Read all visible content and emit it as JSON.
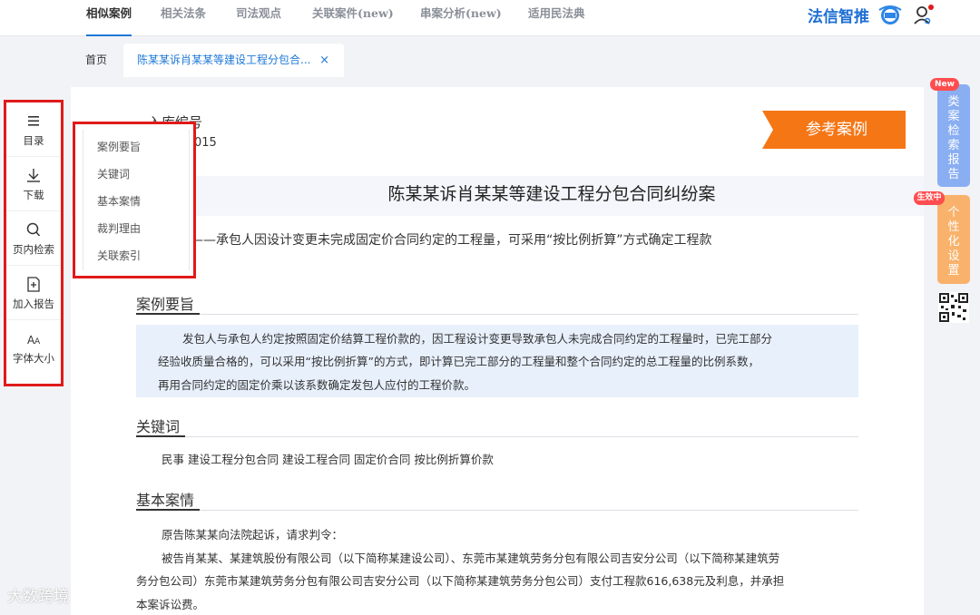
{
  "topnav": {
    "tabs": [
      {
        "label": "相似案例",
        "active": true
      },
      {
        "label": "相关法条",
        "active": false
      },
      {
        "label": "司法观点",
        "active": false
      },
      {
        "label": "关联案件(new)",
        "active": false
      },
      {
        "label": "串案分析(new)",
        "active": false
      },
      {
        "label": "适用民法典",
        "active": false
      }
    ],
    "brand": "法信智推",
    "accent_color": "#1e78d7"
  },
  "pagetabs": {
    "home": "首页",
    "case": "陈某某诉肖某某等建设工程分包合...",
    "close_icon": "×"
  },
  "lefttool": [
    {
      "label": "目录",
      "icon": "list-icon"
    },
    {
      "label": "下载",
      "icon": "download-icon"
    },
    {
      "label": "页内检索",
      "icon": "search-icon"
    },
    {
      "label": "加入报告",
      "icon": "add-report-icon"
    },
    {
      "label": "字体大小",
      "icon": "font-size-icon"
    }
  ],
  "outline": [
    "案例要旨",
    "关键词",
    "基本案情",
    "裁判理由",
    "关联索引"
  ],
  "case": {
    "number_label": "入库编号",
    "number_suffix": "5-015",
    "ref_badge": "参考案例",
    "title": "陈某某诉肖某某等建设工程分包合同纠纷案",
    "subtitle": "——承包人因设计变更未完成固定价合同约定的工程量，可采用“按比例折算”方式确定工程款"
  },
  "sections": {
    "summary": {
      "heading": "案例要旨",
      "lines": [
        "发包人与承包人约定按照固定价结算工程价款的，因工程设计变更导致承包人未完成合同约定的工程量时，已完工部分",
        "经验收质量合格的，可以采用“按比例折算”的方式，即计算已完工部分的工程量和整个合同约定的总工程量的比例系数，",
        "再用合同约定的固定价乘以该系数确定发包人应付的工程价款。"
      ]
    },
    "keywords": {
      "heading": "关键词",
      "text": "民事 建设工程分包合同 建设工程合同 固定价合同 按比例折算价款"
    },
    "facts": {
      "heading": "基本案情",
      "lines": [
        "原告陈某某向法院起诉，请求判令：",
        "被告肖某某、某建筑股份有限公司（以下简称某建设公司）、东莞市某建筑劳务分包有限公司吉安分公司（以下简称某建筑劳",
        "务分包公司）东莞市某建筑劳务分包有限公司吉安分公司（以下简称某建筑劳务分包公司）支付工程款616,638元及利息，并承担",
        "本案诉讼费。"
      ]
    }
  },
  "right_float": {
    "report": {
      "badge": "New",
      "label": "类案检索报告"
    },
    "personal": {
      "badge": "生效中",
      "label": "个性化设置"
    }
  },
  "watermark": "大数跨境"
}
